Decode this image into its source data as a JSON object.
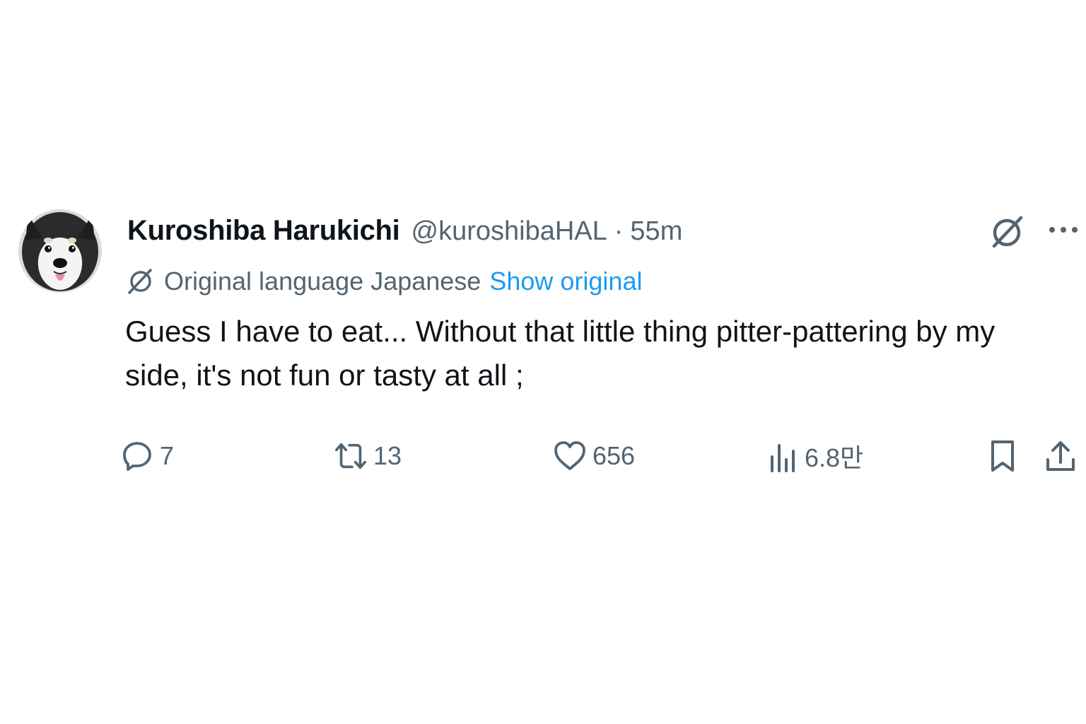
{
  "author": {
    "name": "Kuroshiba Harukichi",
    "handle": "@kuroshibaHAL",
    "separator": "·",
    "time": "55m"
  },
  "translation": {
    "label": "Original language Japanese",
    "show_original": "Show original"
  },
  "tweet": {
    "text": "Guess I have to eat... Without that little thing pitter-pattering by my side, it's not fun or tasty at all ;"
  },
  "actions": {
    "replies": "7",
    "retweets": "13",
    "likes": "656",
    "views": "6.8만"
  },
  "icons": {
    "header": [
      "grok-icon",
      "more-icon"
    ],
    "translation": "grok-icon",
    "actions": [
      "reply-icon",
      "retweet-icon",
      "like-icon",
      "views-icon",
      "bookmark-icon",
      "share-icon"
    ]
  },
  "colors": {
    "text_primary": "#0f1419",
    "text_secondary": "#536471",
    "link": "#1d9bf0",
    "background": "#ffffff"
  }
}
